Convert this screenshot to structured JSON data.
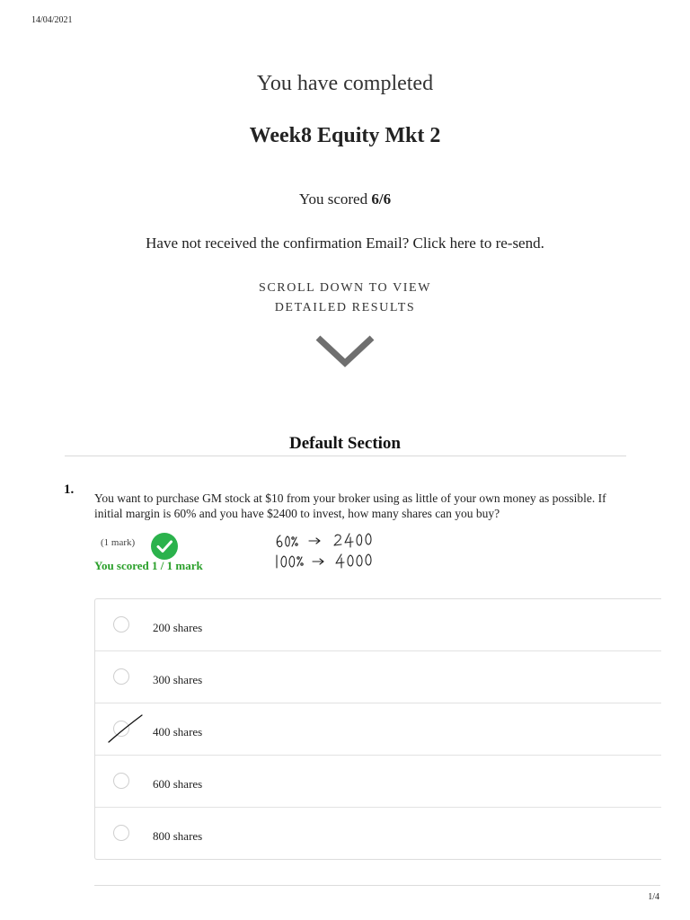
{
  "page": {
    "date": "14/04/2021",
    "page_number": "1/4"
  },
  "header": {
    "completed_text": "You have completed",
    "quiz_title": "Week8 Equity Mkt 2",
    "score_prefix": "You scored ",
    "score_value": "6/6",
    "resend_text": "Have not received the confirmation Email? Click here to re-send.",
    "scroll_line1": "SCROLL DOWN TO VIEW",
    "scroll_line2": "DETAILED RESULTS"
  },
  "section": {
    "title": "Default Section"
  },
  "question": {
    "number": "1.",
    "text": "You want to purchase GM stock at $10 from your broker using as little of your own money as possible. If initial margin is 60% and you have $2400 to invest, how many shares can you buy?",
    "mark_label": "(1 mark)",
    "scored_text": "You scored 1 / 1 mark",
    "status_color": "#2bb24c",
    "handwritten_notes": [
      "60% → 2400",
      "100% → 4000"
    ],
    "options": [
      {
        "label": "200 shares",
        "selected": false
      },
      {
        "label": "300 shares",
        "selected": false
      },
      {
        "label": "400 shares",
        "selected": true
      },
      {
        "label": "600 shares",
        "selected": false
      },
      {
        "label": "800 shares",
        "selected": false
      }
    ]
  }
}
